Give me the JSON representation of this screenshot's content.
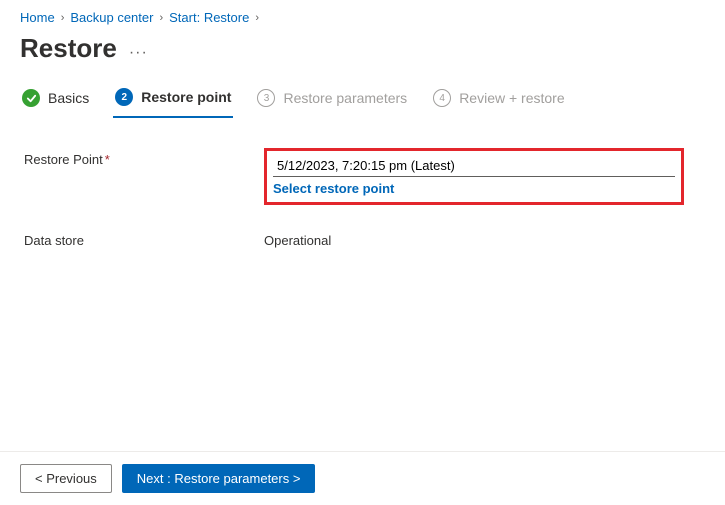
{
  "breadcrumb": {
    "items": [
      "Home",
      "Backup center",
      "Start: Restore"
    ]
  },
  "page_title": "Restore",
  "tabs": {
    "basics": {
      "label": "Basics"
    },
    "restore_point": {
      "label": "Restore point",
      "num": "2"
    },
    "restore_params": {
      "label": "Restore parameters",
      "num": "3"
    },
    "review": {
      "label": "Review + restore",
      "num": "4"
    }
  },
  "form": {
    "restore_point_label": "Restore Point",
    "restore_point_value": "5/12/2023, 7:20:15 pm (Latest)",
    "select_link": "Select restore point",
    "data_store_label": "Data store",
    "data_store_value": "Operational"
  },
  "footer": {
    "previous": "< Previous",
    "next": "Next : Restore parameters >"
  }
}
